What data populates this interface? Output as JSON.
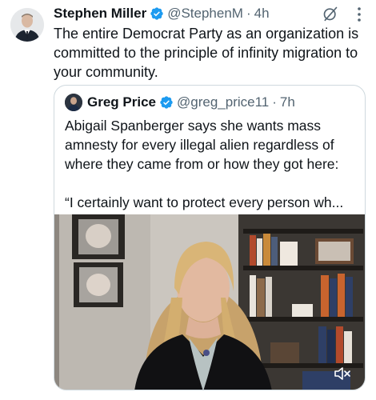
{
  "tweet": {
    "author_name": "Stephen Miller",
    "handle": "@StephenM",
    "separator": "·",
    "time": "4h",
    "text": "The entire Democrat Party as an organization is committed to the principle of infinity migration to your community."
  },
  "quote": {
    "author_name": "Greg Price",
    "handle": "@greg_price11",
    "separator": "·",
    "time": "7h",
    "text_p1": "Abigail Spanberger says she wants mass amnesty for every illegal alien regardless of where they came from or how they got here:",
    "text_p2": "“I certainly want to protect every person wh..."
  },
  "icons": {
    "verified": "verified-badge-icon",
    "grok": "grok-icon",
    "more": "more-options-icon",
    "mute": "volume-muted-icon"
  },
  "colors": {
    "verified_blue": "#1d9bf0",
    "text": "#0f1419",
    "secondary_text": "#536471",
    "border": "#cfd9de"
  }
}
